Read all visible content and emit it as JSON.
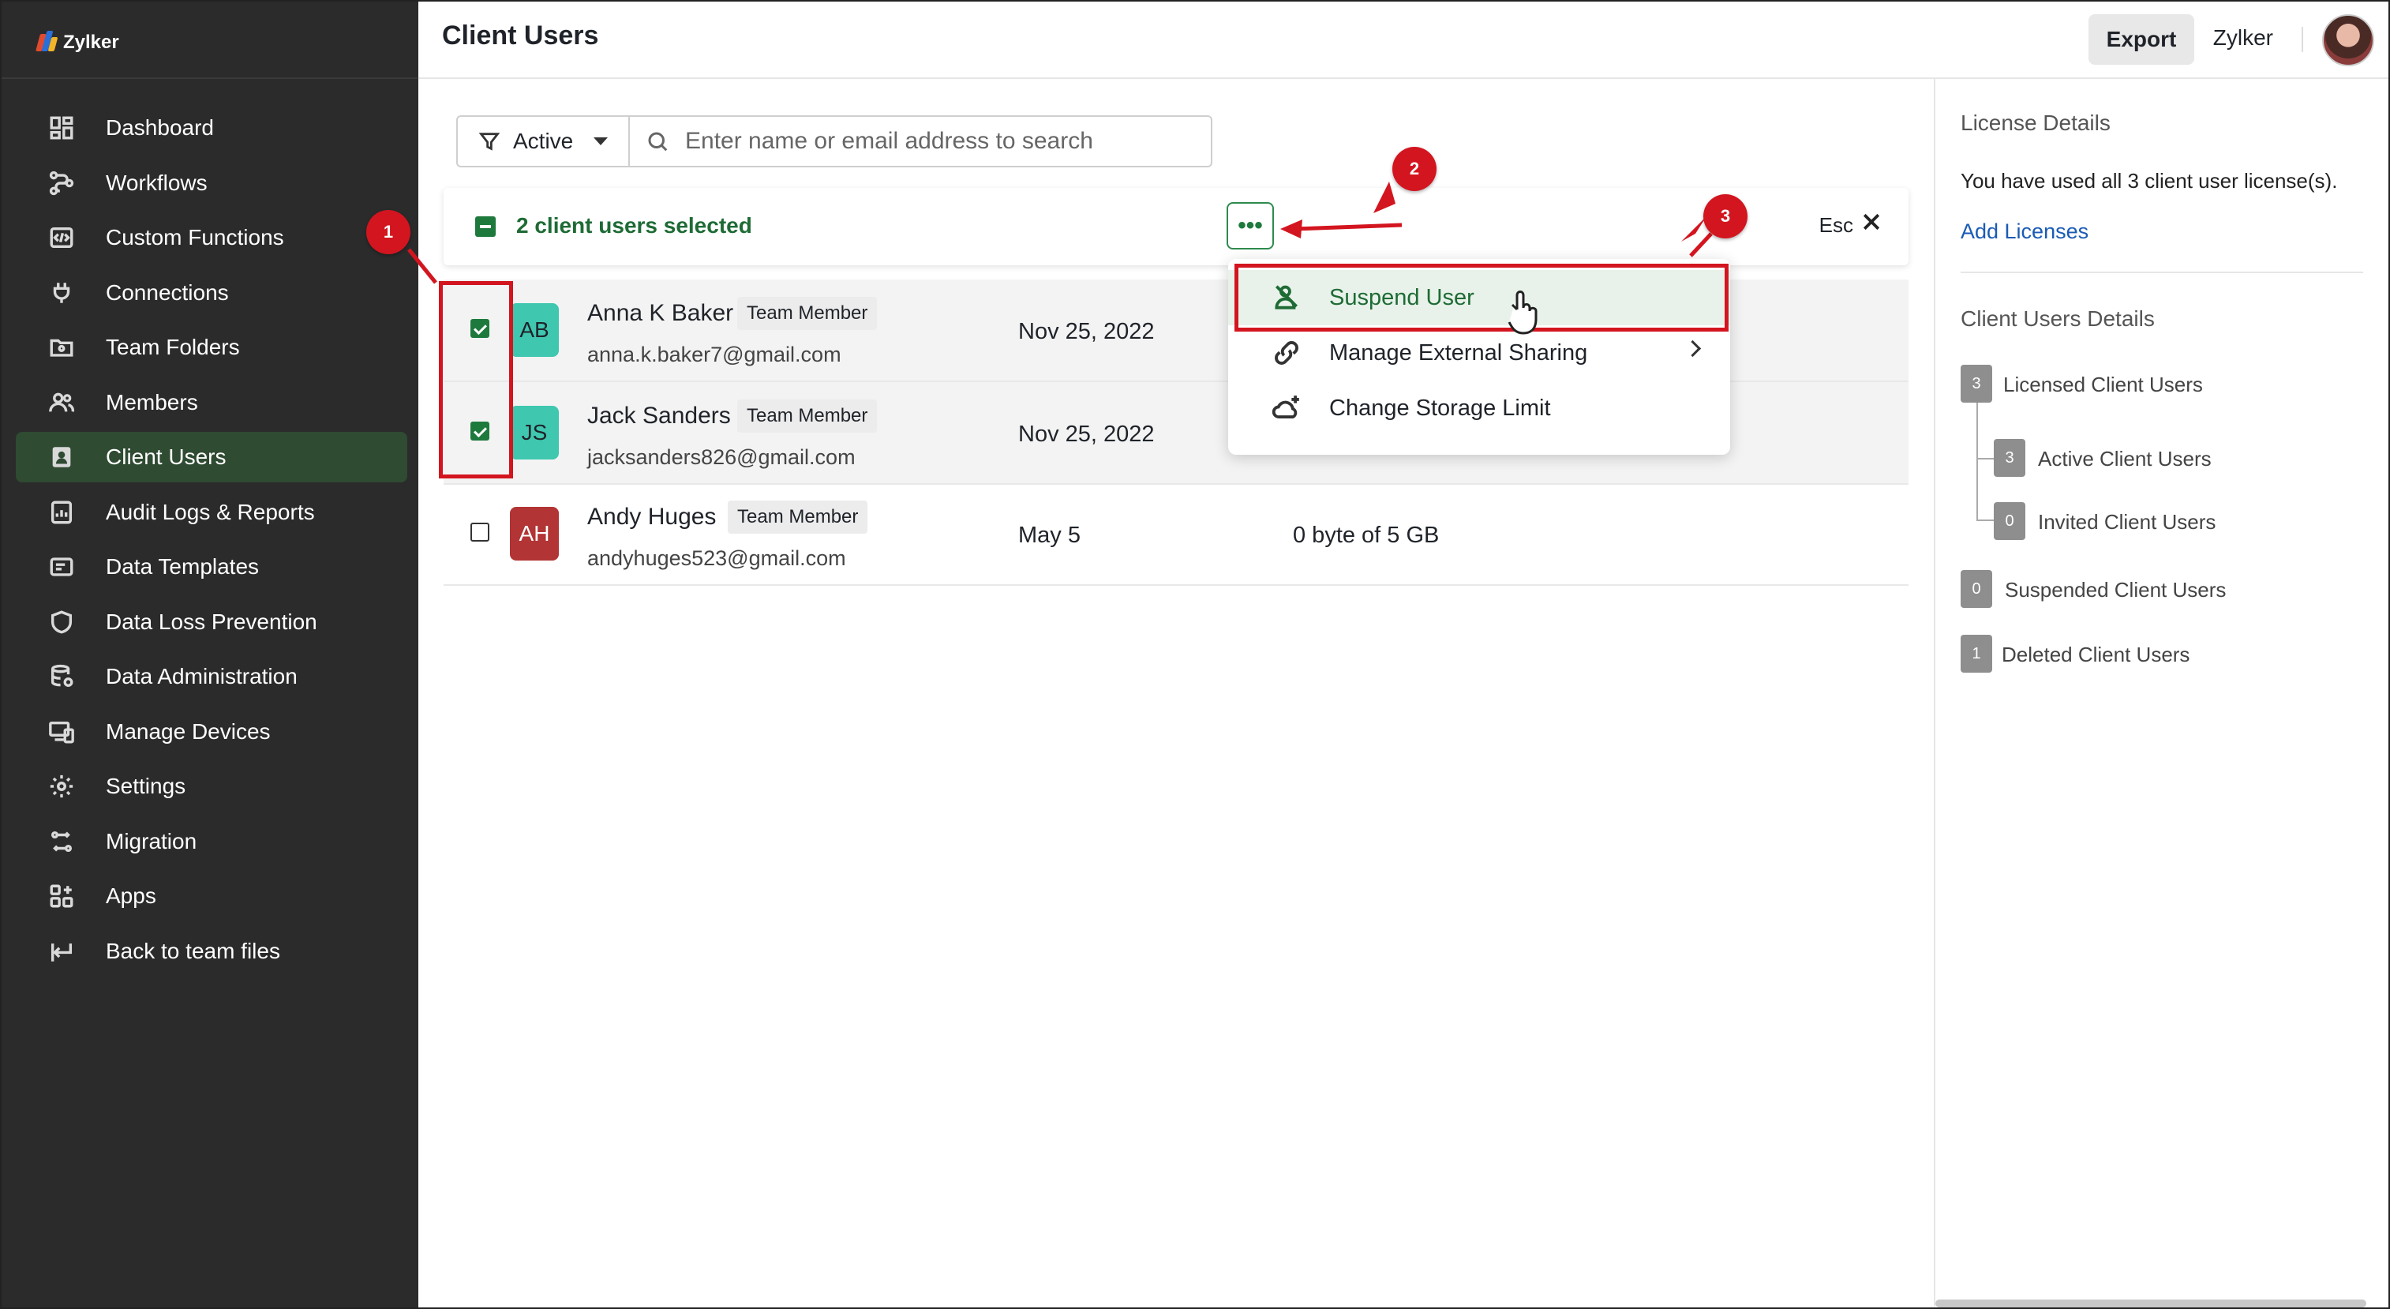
{
  "brand": {
    "name": "Zylker"
  },
  "sidebar": {
    "items": [
      {
        "label": "Dashboard",
        "icon": "dashboard-icon"
      },
      {
        "label": "Workflows",
        "icon": "workflow-icon"
      },
      {
        "label": "Custom Functions",
        "icon": "code-icon"
      },
      {
        "label": "Connections",
        "icon": "plug-icon"
      },
      {
        "label": "Team Folders",
        "icon": "folder-icon"
      },
      {
        "label": "Members",
        "icon": "users-icon"
      },
      {
        "label": "Client Users",
        "icon": "client-user-icon",
        "active": true
      },
      {
        "label": "Audit Logs & Reports",
        "icon": "report-icon"
      },
      {
        "label": "Data Templates",
        "icon": "template-icon"
      },
      {
        "label": "Data Loss Prevention",
        "icon": "shield-icon"
      },
      {
        "label": "Data Administration",
        "icon": "database-icon"
      },
      {
        "label": "Manage Devices",
        "icon": "devices-icon"
      },
      {
        "label": "Settings",
        "icon": "gear-icon"
      },
      {
        "label": "Migration",
        "icon": "migration-icon"
      },
      {
        "label": "Apps",
        "icon": "apps-icon"
      },
      {
        "label": "Back to team files",
        "icon": "back-icon"
      }
    ]
  },
  "header": {
    "title": "Client Users",
    "export_label": "Export",
    "org_name": "Zylker"
  },
  "filter": {
    "selected": "Active",
    "search_placeholder": "Enter name or email address to search"
  },
  "selection": {
    "text": "2 client users selected",
    "more_label": "•••",
    "esc_label": "Esc"
  },
  "users": [
    {
      "initials": "AB",
      "name": "Anna K Baker",
      "role": "Team Member",
      "email": "anna.k.baker7@gmail.com",
      "date": "Nov 25, 2022",
      "storage": "",
      "selected": true,
      "avatar_color": "#3fc7b0"
    },
    {
      "initials": "JS",
      "name": "Jack Sanders",
      "role": "Team Member",
      "email": "jacksanders826@gmail.com",
      "date": "Nov 25, 2022",
      "storage": "",
      "selected": true,
      "avatar_color": "#3fc7b0"
    },
    {
      "initials": "AH",
      "name": "Andy Huges",
      "role": "Team Member",
      "email": "andyhuges523@gmail.com",
      "date": "May 5",
      "storage": "0 byte of 5 GB",
      "selected": false,
      "avatar_color": "#b23434"
    }
  ],
  "menu": {
    "items": [
      {
        "label": "Suspend User",
        "icon": "suspend-user-icon",
        "highlighted": true
      },
      {
        "label": "Manage External Sharing",
        "icon": "external-sharing-icon",
        "submenu": true
      },
      {
        "label": "Change Storage Limit",
        "icon": "cloud-plus-icon"
      }
    ]
  },
  "right_panel": {
    "license_title": "License Details",
    "license_text": "You have used all 3 client user license(s).",
    "add_licenses": "Add Licenses",
    "details_title": "Client Users Details",
    "stats": [
      {
        "count": "3",
        "label": "Licensed Client Users"
      },
      {
        "count": "3",
        "label": "Active Client Users"
      },
      {
        "count": "0",
        "label": "Invited Client Users"
      },
      {
        "count": "0",
        "label": "Suspended Client Users"
      },
      {
        "count": "1",
        "label": "Deleted Client Users"
      }
    ]
  },
  "annotations": [
    "1",
    "2",
    "3"
  ],
  "colors": {
    "accent": "#1e7a3c",
    "annotation": "#d3151f",
    "sidebar_bg": "#2b2b2b"
  }
}
